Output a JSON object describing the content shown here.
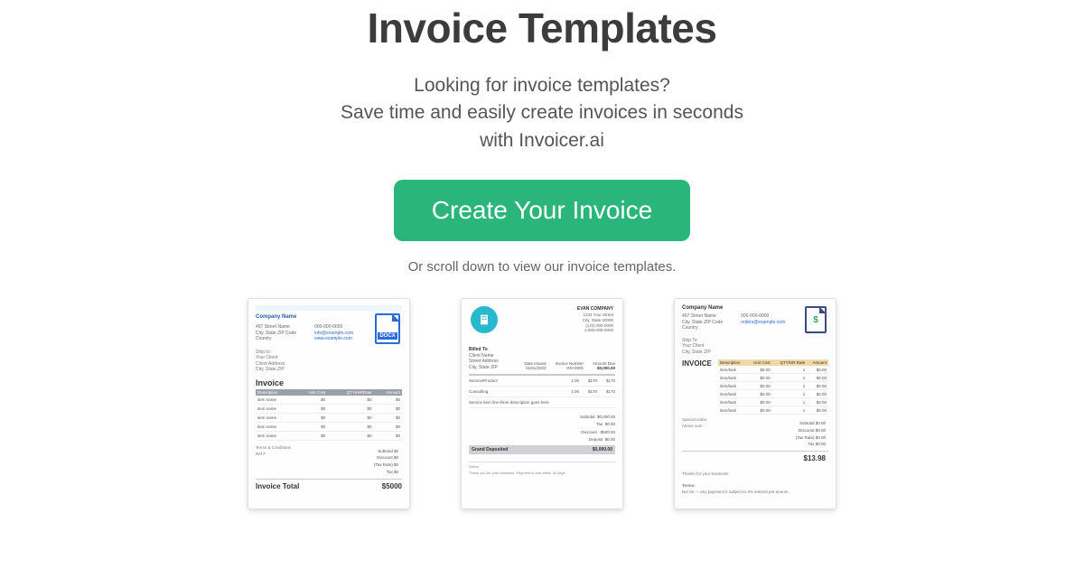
{
  "hero": {
    "title": "Invoice Templates",
    "sub_line1": "Looking for invoice templates?",
    "sub_line2": "Save time and easily create invoices in seconds",
    "sub_line3": "with Invoicer.ai",
    "cta_label": "Create Your Invoice",
    "hint": "Or scroll down to view our invoice templates."
  },
  "t1": {
    "company": "Company Name",
    "badge": "DOCX",
    "addr_left_1": "497 Street Name",
    "addr_left_2": "City, State ZIP Code",
    "addr_left_3": "Country",
    "addr_right_1": "000-000-0000",
    "addr_right_2": "info@example.com",
    "addr_right_3": "www.example.com",
    "ship_1": "Ship to:",
    "ship_2": "Your Client",
    "ship_3": "Client Address",
    "ship_4": "City, State ZIP",
    "invoice": "Invoice",
    "th1": "Description",
    "th2": "Unit Cost",
    "th3": "QTY/HR/Rate",
    "th4": "Amount",
    "r1": "item name",
    "r2": "item name",
    "r3": "item name",
    "r4": "item name",
    "r5": "item name",
    "v0": "$0",
    "tax1": "Subtotal   $0",
    "tax2": "Discount   $0",
    "tax3": "(Tax Rate)   $0",
    "tax4": "Tax   $0",
    "total_l": "Invoice Total",
    "total_r": "$5000",
    "terms": "Terms & Conditions",
    "ref": "Ref #"
  },
  "t2": {
    "co": "EVAN COMPANY",
    "a1": "1234 Your Street",
    "a2": "City, State 00000",
    "a3": "(123) 000-0000",
    "a4": "1-800-000-0000",
    "bill_to": "Billed To",
    "bill_1": "Client Name",
    "bill_2": "Street Address",
    "bill_3": "City, State ZIP",
    "m1": "Date Issued",
    "m1v": "01/01/2023",
    "m2": "Invoice Number",
    "m2v": "INV-0001",
    "m3": "Amount Due",
    "m3v": "$0,000.00",
    "li1": "Service/Product",
    "q": "1.00",
    "p": "$170",
    "li2": "Consulting",
    "li3": "Service item line three description goes here",
    "s1": "Subtotal",
    "s1v": "$0,000.00",
    "s2": "Tax",
    "s2v": "$0.00",
    "s3": "Discount",
    "s3v": "-$500.00",
    "s4": "Deposit",
    "s4v": "$0.00",
    "g": "Grand Deposited",
    "gv": "$0,000.00",
    "n1": "Notes:",
    "n2": "Thank you for your business. Payment is due within 30 days."
  },
  "t3": {
    "company": "Company Name",
    "dollar": "$",
    "a1": "497 Street Name",
    "a2": "City, State ZIP Code",
    "a3": "Country",
    "p1": "000-000-0000",
    "p2": "orders@example.com",
    "ship1": "Ship To",
    "ship2": "Your Client",
    "ship3": "City, State ZIP",
    "invoice": "INVOICE",
    "th1": "Description",
    "th2": "Unit Cost",
    "th3": "QTY/HR Rate",
    "th4": "Amount",
    "r1": "item/task",
    "r2": "item/task",
    "r3": "item/task",
    "r4": "item/task",
    "r5": "item/task",
    "r6": "item/task",
    "v": "$0.00",
    "vq": "1",
    "sl1": "Special notes",
    "sl2": "Above sum",
    "s1": "Subtotal  $0.00",
    "s2": "Discount  $0.00",
    "s3": "(Tax Rate)  $0.00",
    "s4": "Tax  $0.00",
    "total": "$13.98",
    "thanks": "Thanks for your business!",
    "terms": "Terms:",
    "terms_txt": "Net 60 — any payment is subject to 3% interest per annum."
  }
}
